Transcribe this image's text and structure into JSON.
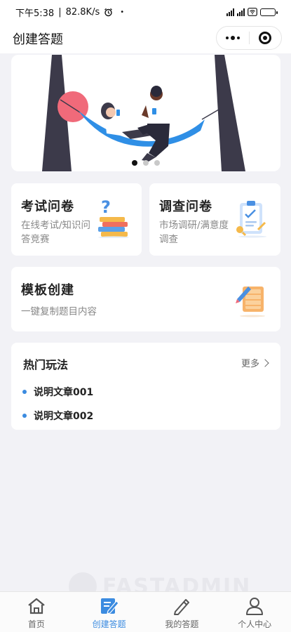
{
  "status_bar": {
    "time": "下午5:38",
    "speed": "82.8K/s",
    "battery_level": 0.6
  },
  "nav": {
    "title": "创建答题"
  },
  "banner": {
    "slides_count": 3,
    "active_index": 0
  },
  "cards": {
    "exam": {
      "title": "考试问卷",
      "desc": "在线考试/知识问答竞赛",
      "icon": "books-question-icon"
    },
    "survey": {
      "title": "调查问卷",
      "desc": "市场调研/满意度调查",
      "icon": "clipboard-check-icon"
    },
    "template": {
      "title": "模板创建",
      "desc": "一键复制题目内容",
      "icon": "notebook-pen-icon"
    }
  },
  "hot": {
    "title": "热门玩法",
    "more": "更多",
    "items": [
      {
        "label": "说明文章001"
      },
      {
        "label": "说明文章002"
      }
    ]
  },
  "watermark": "FASTADMIN",
  "tab_bar": {
    "active": 1,
    "tabs": [
      {
        "label": "首页",
        "icon": "home-icon"
      },
      {
        "label": "创建答题",
        "icon": "edit-icon"
      },
      {
        "label": "我的答题",
        "icon": "pencil-icon"
      },
      {
        "label": "个人中心",
        "icon": "user-icon"
      }
    ]
  },
  "colors": {
    "accent": "#3b8be0",
    "background": "#f2f2f6",
    "hammock": "#2f8fe6",
    "sun": "#f06a7a",
    "tree": "#3c3a4a"
  }
}
